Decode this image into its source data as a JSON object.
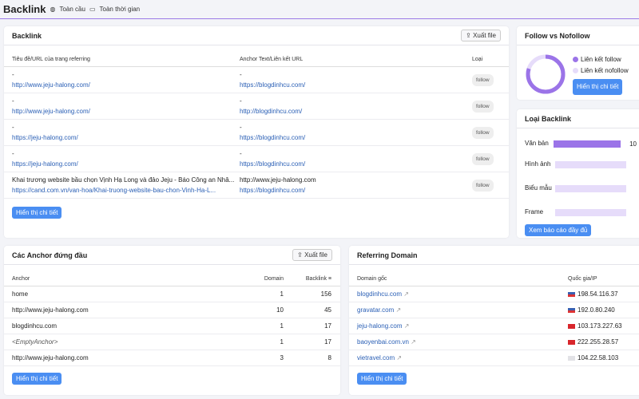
{
  "header": {
    "title": "Backlink",
    "region": "Toàn cầu",
    "period": "Toàn thời gian"
  },
  "backlinks": {
    "title": "Backlink",
    "export": "Xuất file",
    "columns": [
      "Tiêu đề/URL của trang referring",
      "Anchor Text/Liên kết URL",
      "Loại"
    ],
    "rows": [
      {
        "title": "-",
        "url": "http://www.jeju-halong.com/",
        "anchor": "-",
        "target": "https://blogdinhcu.com/",
        "type": "follow"
      },
      {
        "title": "-",
        "url": "http://www.jeju-halong.com/",
        "anchor": "-",
        "target": "http://blogdinhcu.com/",
        "type": "follow"
      },
      {
        "title": "-",
        "url": "https://jeju-halong.com/",
        "anchor": "-",
        "target": "https://blogdinhcu.com/",
        "type": "follow"
      },
      {
        "title": "-",
        "url": "https://jeju-halong.com/",
        "anchor": "-",
        "target": "https://blogdinhcu.com/",
        "type": "follow"
      },
      {
        "title": "Khai trương website bầu chọn Vịnh Hạ Long và đảo Jeju - Báo Công an Nhâ...",
        "url": "https://cand.com.vn/van-hoa/Khai-truong-website-bau-chon-Vinh-Ha-L...",
        "anchor": "http://www.jeju-halong.com",
        "target": "https://blogdinhcu.com/",
        "type": "follow"
      }
    ],
    "details": "Hiển thị chi tiết"
  },
  "follow": {
    "title": "Follow vs Nofollow",
    "legend": [
      "Liên kết follow",
      "Liên kết nofollow"
    ],
    "follow_pct": 80,
    "colors": [
      "#9b74e8",
      "#e6dcfa"
    ],
    "details": "Hiển thị chi tiết"
  },
  "types": {
    "title": "Loại Backlink",
    "items": [
      {
        "label": "Văn bản",
        "pct": 100,
        "text": "10"
      },
      {
        "label": "Hình ảnh",
        "pct": 0
      },
      {
        "label": "Biểu mẫu",
        "pct": 0
      },
      {
        "label": "Frame",
        "pct": 0
      }
    ],
    "report": "Xem báo cáo đầy đủ"
  },
  "anchors": {
    "title": "Các Anchor đứng đầu",
    "export": "Xuất file",
    "columns": [
      "Anchor",
      "Domain",
      "Backlink"
    ],
    "rows": [
      [
        "home",
        "1",
        "156"
      ],
      [
        "http://www.jeju-halong.com",
        "10",
        "45"
      ],
      [
        "blogdinhcu.com",
        "1",
        "17"
      ],
      [
        "<EmptyAnchor>",
        "1",
        "17"
      ],
      [
        "http://www.jeju-halong.com",
        "3",
        "8"
      ]
    ],
    "details": "Hiển thị chi tiết"
  },
  "domains": {
    "title": "Referring Domain",
    "columns": [
      "Domain gốc",
      "Quốc gia/IP"
    ],
    "rows": [
      {
        "domain": "blogdinhcu.com",
        "flag": "us",
        "ip": "198.54.116.37"
      },
      {
        "domain": "gravatar.com",
        "flag": "us",
        "ip": "192.0.80.240"
      },
      {
        "domain": "jeju-halong.com",
        "flag": "vn",
        "ip": "103.173.227.63"
      },
      {
        "domain": "baoyenbai.com.vn",
        "flag": "vn",
        "ip": "222.255.28.57"
      },
      {
        "domain": "vietravel.com",
        "flag": "none",
        "ip": "104.22.58.103"
      }
    ],
    "details": "Hiển thị chi tiết"
  }
}
